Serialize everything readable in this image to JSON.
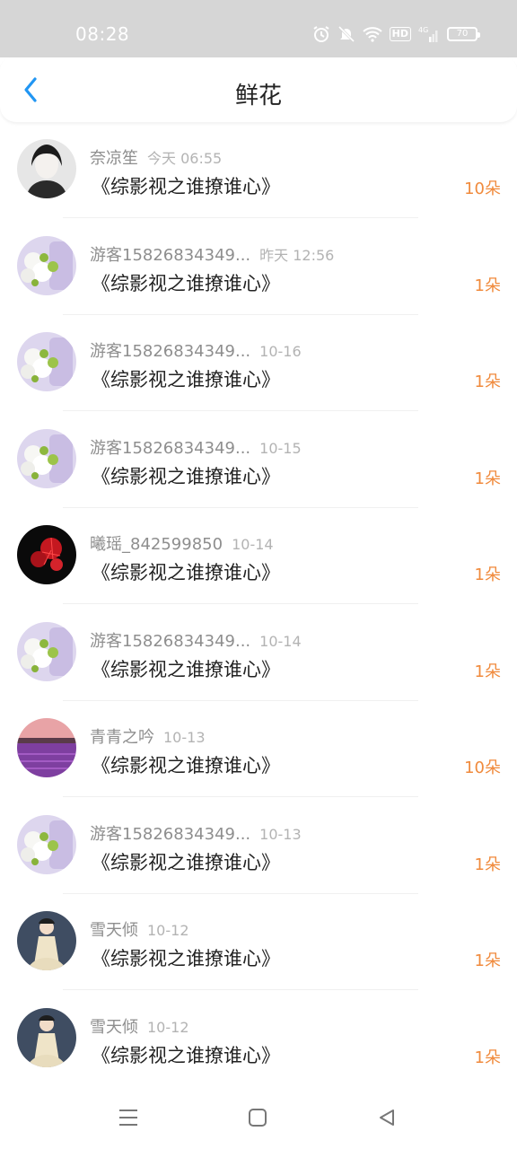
{
  "status_bar": {
    "time": "08:28",
    "hd": "HD",
    "network": "4G",
    "battery": "70"
  },
  "header": {
    "title": "鲜花",
    "back_icon": "chevron-left-icon"
  },
  "colors": {
    "accent": "#2196f3",
    "amount": "#f08a3c",
    "username": "#8e8e8e",
    "time": "#b3b3b3"
  },
  "rows": [
    {
      "user": "奈凉笙",
      "time": "今天 06:55",
      "book": "《综影视之谁撩谁心》",
      "amount": "10朵",
      "avatar": "portrait-woman"
    },
    {
      "user": "游客15826834349...",
      "time": "昨天 12:56",
      "book": "《综影视之谁撩谁心》",
      "amount": "1朵",
      "avatar": "flowers"
    },
    {
      "user": "游客15826834349...",
      "time": "10-16",
      "book": "《综影视之谁撩谁心》",
      "amount": "1朵",
      "avatar": "flowers"
    },
    {
      "user": "游客15826834349...",
      "time": "10-15",
      "book": "《综影视之谁撩谁心》",
      "amount": "1朵",
      "avatar": "flowers"
    },
    {
      "user": "曦瑶_842599850",
      "time": "10-14",
      "book": "《综影视之谁撩谁心》",
      "amount": "1朵",
      "avatar": "red-flower"
    },
    {
      "user": "游客15826834349...",
      "time": "10-14",
      "book": "《综影视之谁撩谁心》",
      "amount": "1朵",
      "avatar": "flowers"
    },
    {
      "user": "青青之吟",
      "time": "10-13",
      "book": "《综影视之谁撩谁心》",
      "amount": "10朵",
      "avatar": "lavender"
    },
    {
      "user": "游客15826834349...",
      "time": "10-13",
      "book": "《综影视之谁撩谁心》",
      "amount": "1朵",
      "avatar": "flowers"
    },
    {
      "user": "雪天倾",
      "time": "10-12",
      "book": "《综影视之谁撩谁心》",
      "amount": "1朵",
      "avatar": "hanfu-girl"
    },
    {
      "user": "雪天倾",
      "time": "10-12",
      "book": "《综影视之谁撩谁心》",
      "amount": "1朵",
      "avatar": "hanfu-girl"
    }
  ],
  "nav": {
    "menu_icon": "menu-icon",
    "home_icon": "home-square-icon",
    "back_icon": "back-triangle-icon"
  }
}
